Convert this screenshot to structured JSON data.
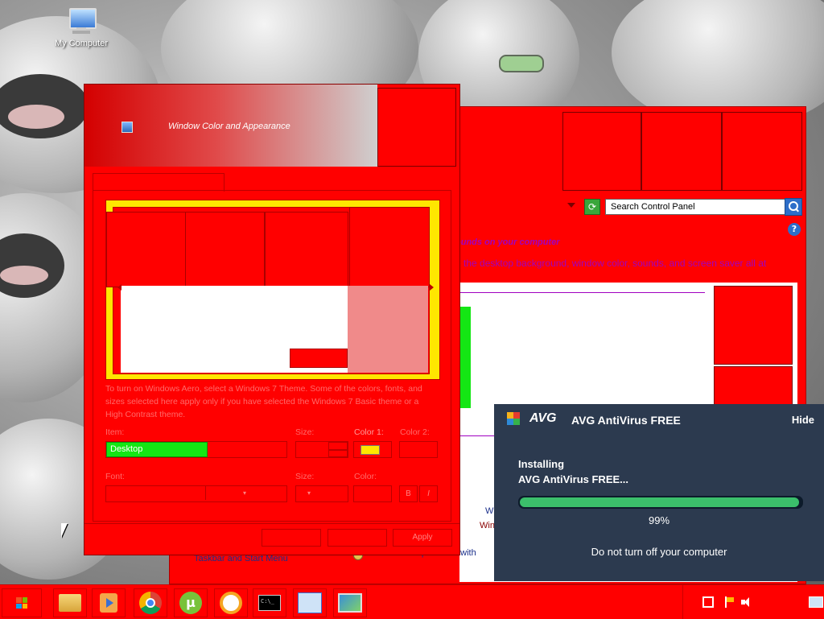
{
  "desktop": {
    "icons": [
      {
        "label": "My Computer",
        "icon": "computer-icon"
      }
    ]
  },
  "dialog": {
    "title": "Window Color and Appearance",
    "instructions": "To turn on Windows Aero, select a Windows 7 Theme. Some of the colors, fonts, and sizes selected here apply only if you have selected the Windows 7 Basic theme or a High Contrast theme.",
    "item_label": "Item:",
    "item_value": "Desktop",
    "size_label": "Size:",
    "color1_label": "Color 1:",
    "color2_label": "Color 2:",
    "font_label": "Font:",
    "font_size_label": "Size:",
    "font_color_label": "Color:",
    "bold_label": "B",
    "italic_label": "I",
    "apply_label": "Apply",
    "color1_value": "#ffe600",
    "item_value_bg": "#14e614"
  },
  "control_panel": {
    "search_placeholder": "Search Control Panel",
    "heading": "ounds on your computer",
    "description": "e the desktop background, window color, sounds, and screen saver all at",
    "link_partial_1": "W",
    "link_partial_2": "Win",
    "taskbar_link": "Taskbar and Start Menu",
    "troubleshoot_link": "Troubleshoot problems with"
  },
  "avg": {
    "brand": "AVG",
    "title": "AVG AntiVirus FREE",
    "hide_label": "Hide",
    "status_line1": "Installing",
    "status_line2": "AVG AntiVirus FREE...",
    "progress": 0.99,
    "progress_label": "99%",
    "footer": "Do not turn off your computer"
  },
  "taskbar": {
    "apps": [
      "start-icon",
      "file-explorer-icon",
      "media-player-icon",
      "chrome-icon",
      "utorrent-icon",
      "avast-secure-browser-icon",
      "command-prompt-icon",
      "control-panel-icon",
      "display-settings-icon"
    ],
    "tray": [
      "network-icon",
      "action-center-flag-icon",
      "volume-icon",
      "show-desktop-icon"
    ]
  }
}
